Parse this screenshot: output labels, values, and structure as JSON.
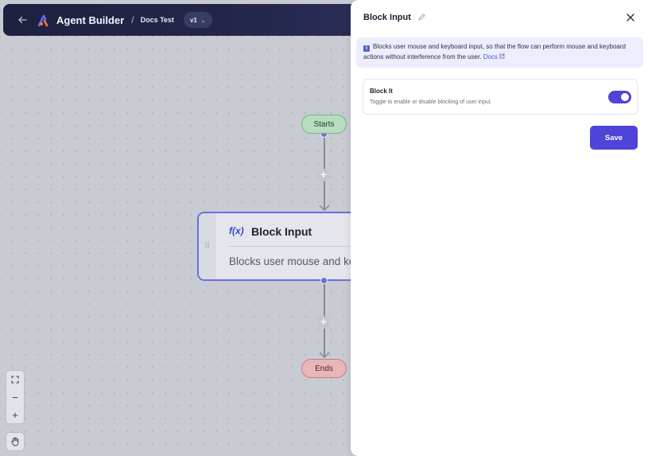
{
  "header": {
    "app_title": "Agent Builder",
    "breadcrumb_separator": "/",
    "project_name": "Docs Test",
    "version": "v1"
  },
  "flow": {
    "start_label": "Starts",
    "end_label": "Ends",
    "node": {
      "icon_label": "f(x)",
      "title": "Block Input",
      "description": "Blocks user mouse and keyboard input, so that the flow can perform mouse and keyboard actions without interference from the user."
    }
  },
  "zoom_controls": {
    "fit": "⛶",
    "zoom_out": "−",
    "zoom_in": "+"
  },
  "panel": {
    "title": "Block Input",
    "info_text": "Blocks user mouse and keyboard input, so that the flow can perform mouse and keyboard actions without interference from the user.",
    "docs_link": "Docs",
    "setting": {
      "label": "Block It",
      "help": "Toggle to enable or disable blocking of user input.",
      "enabled": true
    },
    "save_label": "Save"
  },
  "colors": {
    "accent": "#4e44d8",
    "start_pill": "#b8dcc0",
    "end_pill": "#e6b6b8",
    "topbar": "#1e2140"
  }
}
